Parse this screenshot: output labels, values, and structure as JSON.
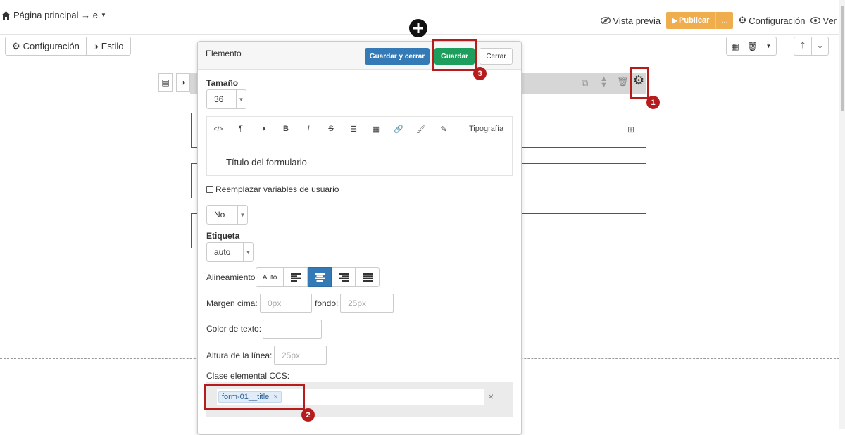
{
  "topbar": {
    "breadcrumb": "Página principal → e",
    "preview": "Vista previa",
    "publish": "Publicar",
    "publish_more": "...",
    "settings": "Configuración",
    "view": "Ver"
  },
  "left_tabs": {
    "config": "Configuración",
    "style": "Estilo"
  },
  "modal": {
    "title": "Elemento",
    "save_close": "Guardar y cerrar",
    "save": "Guardar",
    "close": "Cerrar",
    "size_label": "Tamaño",
    "size_value": "36",
    "toolbar_typography": "Tipografía",
    "editor_text": "Título del formulario",
    "replace_vars": "Reemplazar variables de usuario",
    "no_value": "No",
    "tag_label": "Etiqueta",
    "tag_value": "auto",
    "align_label": "Alineamiento",
    "align_auto": "Auto",
    "margin_top_label": "Margen cima:",
    "margin_top_placeholder": "0px",
    "bottom_label": "fondo:",
    "bottom_placeholder": "25px",
    "text_color_label": "Color de texto:",
    "line_height_label": "Altura de la línea:",
    "line_height_placeholder": "25px",
    "css_class_label": "Clase elemental CCS:",
    "css_tag": "form-01__title",
    "tag_remove": "×",
    "clear_tags": "×"
  },
  "annotations": {
    "badge1": "1",
    "badge2": "2",
    "badge3": "3"
  },
  "colors": {
    "publish": "#f0ad4e",
    "save": "#1e9e5d",
    "save_close": "#337ab7",
    "highlight": "#b71c1c",
    "active_align": "#337ab7"
  },
  "icons": [
    "home-icon",
    "eye-icon",
    "gear-icon",
    "adjust-icon",
    "trash-icon",
    "arrow-up-icon",
    "arrow-down-icon",
    "plus-circle-icon"
  ]
}
